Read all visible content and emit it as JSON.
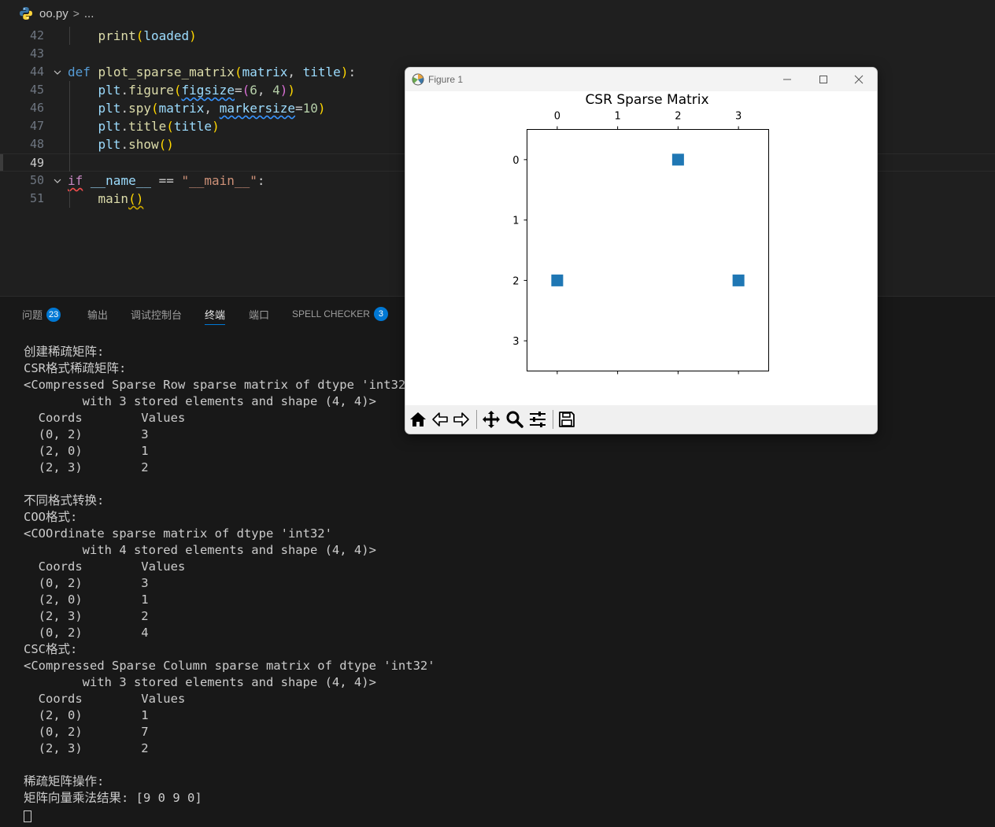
{
  "breadcrumb": {
    "file": "oo.py",
    "separator": ">",
    "ellipsis": "..."
  },
  "editor": {
    "lines": [
      {
        "n": "42",
        "seg": [
          [
            "",
            "    "
          ],
          [
            "fn",
            "print"
          ],
          [
            "p1",
            "("
          ],
          [
            "var",
            "loaded"
          ],
          [
            "p1",
            ")"
          ]
        ]
      },
      {
        "n": "43",
        "seg": []
      },
      {
        "n": "44",
        "seg": [
          [
            "kw",
            "def"
          ],
          [
            "",
            " "
          ],
          [
            "fn",
            "plot_sparse_matrix"
          ],
          [
            "p1",
            "("
          ],
          [
            "var",
            "matrix"
          ],
          [
            "",
            ", "
          ],
          [
            "var",
            "title"
          ],
          [
            "p1",
            ")"
          ],
          [
            "",
            ":"
          ]
        ]
      },
      {
        "n": "45",
        "seg": [
          [
            "",
            "    "
          ],
          [
            "var",
            "plt"
          ],
          [
            "",
            "."
          ],
          [
            "fn",
            "figure"
          ],
          [
            "p1",
            "("
          ],
          [
            "var wavy-blue",
            "figsize"
          ],
          [
            "",
            "="
          ],
          [
            "p2",
            "("
          ],
          [
            "num",
            "6"
          ],
          [
            "",
            ", "
          ],
          [
            "num",
            "4"
          ],
          [
            "p2",
            ")"
          ],
          [
            "p1",
            ")"
          ]
        ]
      },
      {
        "n": "46",
        "seg": [
          [
            "",
            "    "
          ],
          [
            "var",
            "plt"
          ],
          [
            "",
            "."
          ],
          [
            "fn",
            "spy"
          ],
          [
            "p1",
            "("
          ],
          [
            "var",
            "matrix"
          ],
          [
            "",
            ", "
          ],
          [
            "var wavy-blue",
            "markersize"
          ],
          [
            "",
            "="
          ],
          [
            "num",
            "10"
          ],
          [
            "p1",
            ")"
          ]
        ]
      },
      {
        "n": "47",
        "seg": [
          [
            "",
            "    "
          ],
          [
            "var",
            "plt"
          ],
          [
            "",
            "."
          ],
          [
            "fn",
            "title"
          ],
          [
            "p1",
            "("
          ],
          [
            "var",
            "title"
          ],
          [
            "p1",
            ")"
          ]
        ]
      },
      {
        "n": "48",
        "seg": [
          [
            "",
            "    "
          ],
          [
            "var",
            "plt"
          ],
          [
            "",
            "."
          ],
          [
            "fn",
            "show"
          ],
          [
            "p1",
            "()"
          ]
        ]
      },
      {
        "n": "49",
        "seg": []
      },
      {
        "n": "50",
        "seg": [
          [
            "kw2 wavy-red",
            "if"
          ],
          [
            "",
            " "
          ],
          [
            "var",
            "__name__"
          ],
          [
            "",
            " == "
          ],
          [
            "str",
            "\"__main__\""
          ],
          [
            "",
            ":"
          ]
        ]
      },
      {
        "n": "51",
        "seg": [
          [
            "",
            "    "
          ],
          [
            "fn",
            "main"
          ],
          [
            "p1 wavy-yellow",
            "()"
          ]
        ]
      }
    ]
  },
  "panel": {
    "tabs": [
      {
        "label": "问题",
        "badge": "23"
      },
      {
        "label": "输出",
        "badge": ""
      },
      {
        "label": "调试控制台",
        "badge": ""
      },
      {
        "label": "终端",
        "badge": ""
      },
      {
        "label": "端口",
        "badge": ""
      },
      {
        "label": "SPELL CHECKER",
        "badge": "3"
      }
    ],
    "terminal_lines": [
      "创建稀疏矩阵:",
      "CSR格式稀疏矩阵:",
      "<Compressed Sparse Row sparse matrix of dtype 'int32'",
      "        with 3 stored elements and shape (4, 4)>",
      "  Coords        Values",
      "  (0, 2)        3",
      "  (2, 0)        1",
      "  (2, 3)        2",
      "",
      "不同格式转换:",
      "COO格式:",
      "<COOrdinate sparse matrix of dtype 'int32'",
      "        with 4 stored elements and shape (4, 4)>",
      "  Coords        Values",
      "  (0, 2)        3",
      "  (2, 0)        1",
      "  (2, 3)        2",
      "  (0, 2)        4",
      "CSC格式:",
      "<Compressed Sparse Column sparse matrix of dtype 'int32'",
      "        with 3 stored elements and shape (4, 4)>",
      "  Coords        Values",
      "  (2, 0)        1",
      "  (0, 2)        7",
      "  (2, 3)        2",
      "",
      "稀疏矩阵操作:",
      "矩阵向量乘法结果: [9 0 9 0]"
    ]
  },
  "figure": {
    "window_title": "Figure 1",
    "toolbar_icons": [
      "home-icon",
      "back-icon",
      "forward-icon",
      "pan-icon",
      "zoom-icon",
      "configure-subplots-icon",
      "save-icon"
    ]
  },
  "chart_data": {
    "type": "scatter",
    "title": "CSR Sparse Matrix",
    "x_ticks": [
      "0",
      "1",
      "2",
      "3"
    ],
    "y_ticks": [
      "0",
      "1",
      "2",
      "3"
    ],
    "xlim": [
      -0.5,
      3.5
    ],
    "ylim": [
      3.5,
      -0.5
    ],
    "x_axis_position": "top",
    "marker": "square",
    "marker_color": "#1f77b4",
    "points": [
      {
        "row": 0,
        "col": 2
      },
      {
        "row": 2,
        "col": 0
      },
      {
        "row": 2,
        "col": 3
      }
    ]
  }
}
